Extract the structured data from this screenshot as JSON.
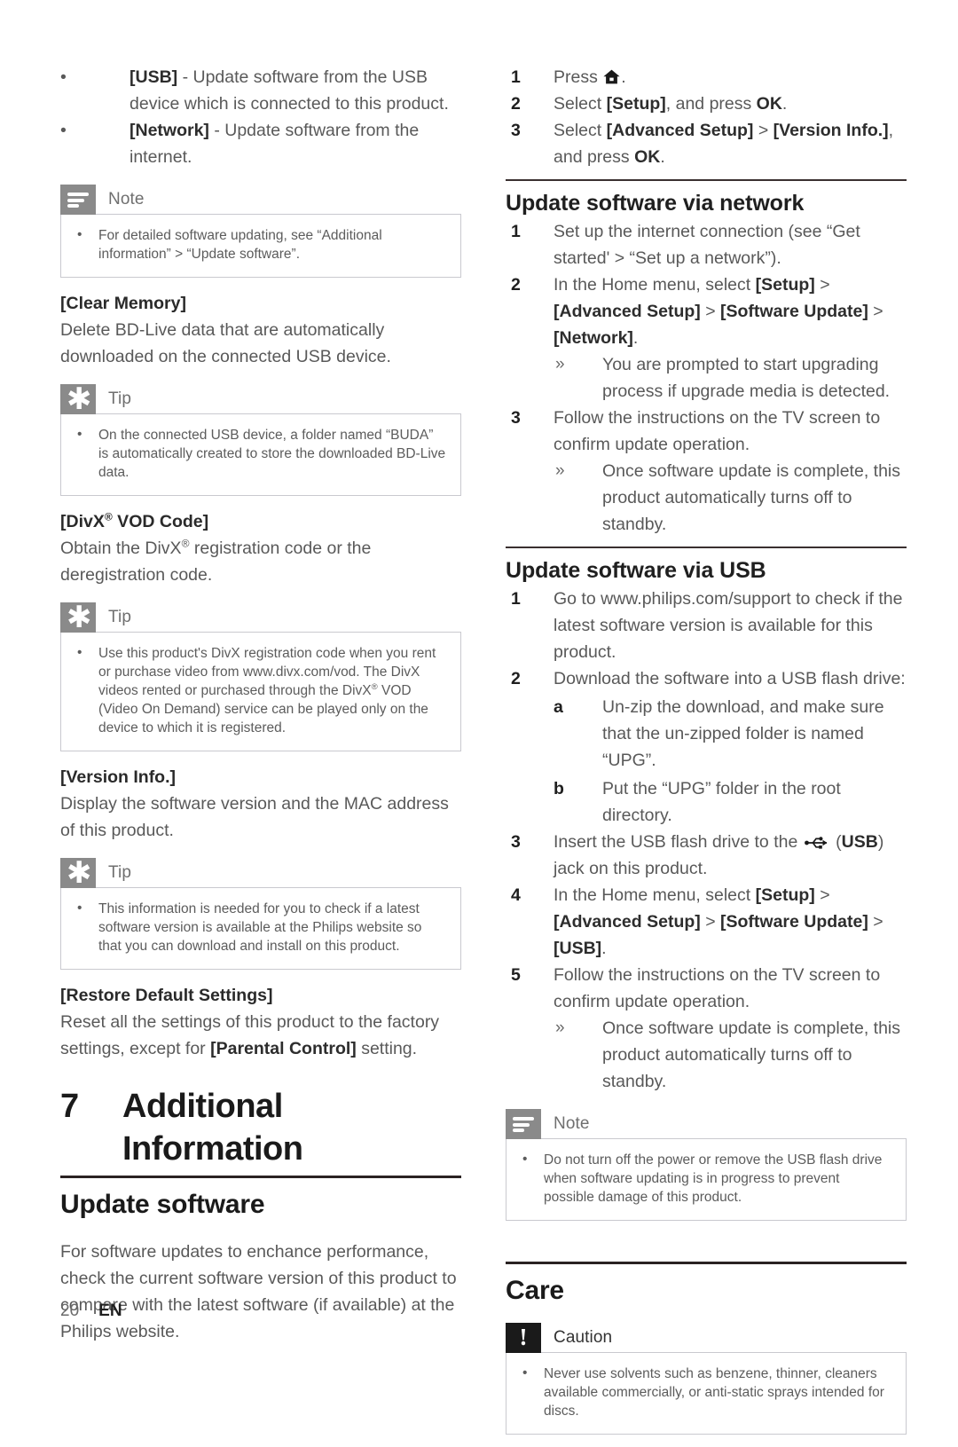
{
  "document": {
    "page_number": "20",
    "language_code": "EN"
  },
  "left_column": {
    "option_bullets": [
      {
        "bullet": "•",
        "label": "[USB]",
        "text": " - Update software from the USB device which is connected to this product."
      },
      {
        "bullet": "•",
        "label": "[Network]",
        "text": " - Update software from the internet."
      }
    ],
    "note_1": {
      "icon": "note-icon",
      "title": "Note",
      "items": [
        "For detailed software updating, see “Additional information” > “Update software”."
      ]
    },
    "clear_memory": {
      "term": "[Clear Memory]",
      "description": "Delete BD-Live data that are automatically downloaded on the connected USB device."
    },
    "tip_1": {
      "icon": "tip-icon",
      "title": "Tip",
      "items": [
        "On the connected USB device, a folder named “BUDA” is automatically created to store the downloaded BD-Live data."
      ]
    },
    "divx_vod": {
      "term_pre": "[DivX",
      "term_sup": "®",
      "term_post": " VOD Code]",
      "description_pre": "Obtain the DivX",
      "description_sup": "®",
      "description_post": " registration code or the deregistration code."
    },
    "tip_2": {
      "icon": "tip-icon",
      "title": "Tip",
      "items_pre": "Use this product's DivX registration code when you rent or purchase video from www.divx.com/vod. The DivX videos rented or purchased through the DivX",
      "items_sup": "®",
      "items_post": " VOD (Video On Demand) service can be played only on the device to which it is registered."
    },
    "version_info": {
      "term": "[Version Info.]",
      "description": "Display the software version and the MAC address of this product."
    },
    "tip_3": {
      "icon": "tip-icon",
      "title": "Tip",
      "items": [
        "This information is needed for you to check if a latest software version is available at the Philips website so that you can download and install on this product."
      ]
    },
    "restore_defaults": {
      "term": "[Restore Default Settings]",
      "description_pre": "Reset all the settings of this product to the factory settings, except for ",
      "description_bold": "[Parental Control]",
      "description_post": " setting."
    },
    "chapter": {
      "number": "7",
      "title": "Additional Information"
    },
    "update_software": {
      "heading": "Update software",
      "paragraph": "For software updates to enchance performance, check the current software version of this product to compare with the latest software (if available) at the Philips website."
    }
  },
  "right_column": {
    "version_steps": [
      {
        "num": "1",
        "pre": "Press ",
        "icon": "home-icon",
        "post": "."
      },
      {
        "num": "2",
        "pre": "Select ",
        "bold1": "[Setup]",
        "mid": ", and press ",
        "bold2": "OK",
        "post": "."
      },
      {
        "num": "3",
        "pre": "Select ",
        "bold1": "[Advanced Setup]",
        "mid": " > ",
        "bold2": "[Version Info.]",
        "post": ", and press ",
        "bold3": "OK",
        "tail": "."
      }
    ],
    "network_section": {
      "heading": "Update software via network",
      "steps": [
        {
          "num": "1",
          "text": "Set up the internet connection (see “Get started' > “Set up a network”)."
        },
        {
          "num": "2",
          "pre": "In the Home menu, select ",
          "bold1": "[Setup]",
          "mid1": " > ",
          "bold2": "[Advanced Setup]",
          "mid2": " > ",
          "bold3": "[Software Update]",
          "mid3": " > ",
          "bold4": "[Network]",
          "post": ".",
          "results": [
            "You are prompted to start upgrading process if upgrade media is detected."
          ]
        },
        {
          "num": "3",
          "text": "Follow the instructions on the TV screen to confirm update operation.",
          "results": [
            "Once software update is complete, this product automatically turns off to standby."
          ]
        }
      ]
    },
    "usb_section": {
      "heading": "Update software via USB",
      "steps": [
        {
          "num": "1",
          "text": "Go to www.philips.com/support to check if the latest software version is available for this product."
        },
        {
          "num": "2",
          "text": "Download the software into a USB flash drive:",
          "substeps": [
            {
              "label": "a",
              "text": "Un-zip the download, and make sure that the un-zipped folder is named “UPG”."
            },
            {
              "label": "b",
              "text": "Put the “UPG” folder in the root directory."
            }
          ]
        },
        {
          "num": "3",
          "pre": "Insert the USB flash drive to the ",
          "icon": "usb-icon",
          "mid": " (",
          "bold1": "USB",
          "post": ") jack on this product."
        },
        {
          "num": "4",
          "pre": "In the Home menu, select ",
          "bold1": "[Setup]",
          "mid1": " > ",
          "bold2": "[Advanced Setup]",
          "mid2": " > ",
          "bold3": "[Software Update]",
          "mid3": " > ",
          "bold4": "[USB]",
          "post": "."
        },
        {
          "num": "5",
          "text": "Follow the instructions on the TV screen to confirm update operation.",
          "results": [
            "Once software update is complete, this product automatically turns off to standby."
          ]
        }
      ]
    },
    "note_2": {
      "icon": "note-icon",
      "title": "Note",
      "items": [
        "Do not turn off the power or remove the USB flash drive when software updating is in progress to prevent possible damage of this product."
      ]
    },
    "care_section": {
      "heading": "Care",
      "caution": {
        "icon": "caution-icon",
        "glyph": "!",
        "title": "Caution",
        "items": [
          "Never use solvents such as benzene, thinner, cleaners available commercially, or anti-static sprays intended for discs."
        ]
      }
    }
  },
  "colors": {
    "badge_gray": "#8a8a8a",
    "badge_dark": "#1a1a1a",
    "body_text": "#595959",
    "heading_text": "#1f1f1f",
    "rule": "#2a2222",
    "box_border": "#c9c9cf"
  }
}
